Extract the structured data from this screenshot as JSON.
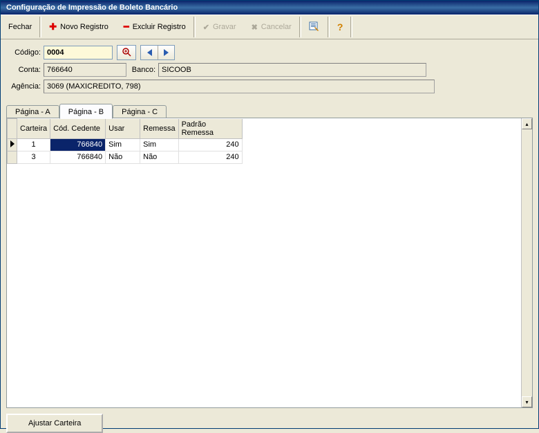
{
  "window": {
    "title": "Configuração de Impressão de Boleto Bancário"
  },
  "toolbar": {
    "close_label": "Fechar",
    "new_label": "Novo Registro",
    "delete_label": "Excluir Registro",
    "save_label": "Gravar",
    "cancel_label": "Cancelar"
  },
  "form": {
    "codigo_label": "Código:",
    "codigo_value": "0004",
    "conta_label": "Conta:",
    "conta_value": "766640",
    "banco_label": "Banco:",
    "banco_value": "SICOOB",
    "agencia_label": "Agência:",
    "agencia_value": "3069 (MAXICREDITO, 798)"
  },
  "tabs": {
    "a": "Página - A",
    "b": "Página - B",
    "c": "Página - C",
    "active": "b"
  },
  "grid": {
    "headers": {
      "carteira": "Carteira",
      "cod_cedente": "Cód. Cedente",
      "usar": "Usar",
      "remessa": "Remessa",
      "padrao_remessa": "Padrão Remessa"
    },
    "rows": [
      {
        "selected": true,
        "carteira": "1",
        "cod_cedente": "766840",
        "usar": "Sim",
        "remessa": "Sim",
        "padrao_remessa": "240"
      },
      {
        "selected": false,
        "carteira": "3",
        "cod_cedente": "766840",
        "usar": "Não",
        "remessa": "Não",
        "padrao_remessa": "240"
      }
    ]
  },
  "footer": {
    "ajustar": "Ajustar Carteira"
  }
}
